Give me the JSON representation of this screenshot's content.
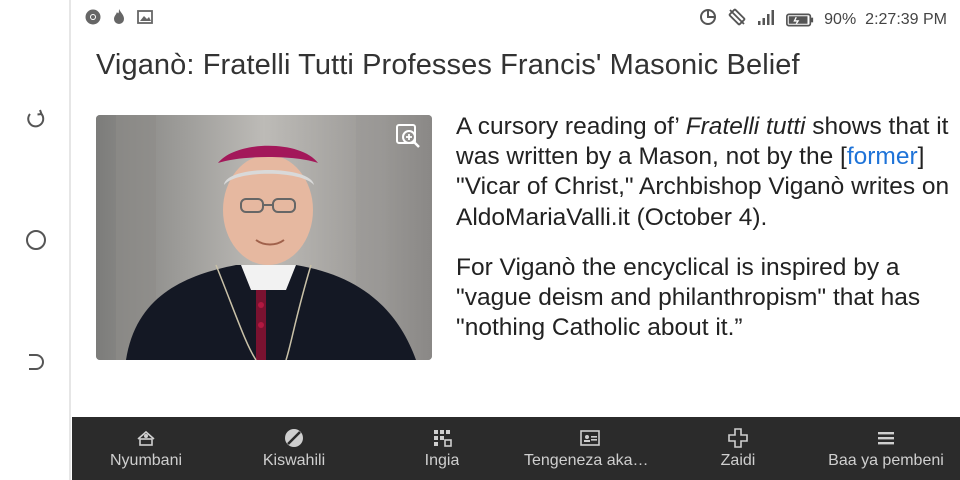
{
  "status_bar": {
    "battery": "90%",
    "time": "2:27:39 PM",
    "left_icons": [
      "chrome-icon",
      "flame-icon",
      "image-icon"
    ],
    "right_icons": [
      "data-saver-icon",
      "rotate-icon",
      "signal-icon",
      "battery-icon"
    ]
  },
  "nav_buttons": [
    "refresh-icon",
    "home-circle-icon",
    "back-icon"
  ],
  "article": {
    "title": "Viganò: Fratelli Tutti Professes Francis' Masonic Belief",
    "paragraph1": {
      "p1": "A cursory reading of’ ",
      "italic": "Fratelli tutti",
      "p2": " shows that it was written by a Mason, not by the [",
      "link": "former",
      "p3": "] \"Vicar of Christ,\" Archbishop Viganò writes on AldoMariaValli.it (October 4)."
    },
    "paragraph2": "For Viganò the encyclical is inspired by a \"vague deism and philanthropism\" that has \"nothing Catholic about it.”"
  },
  "bottom_nav": {
    "tabs": [
      {
        "label": "Nyumbani",
        "icon": "home-icon"
      },
      {
        "label": "Kiswahili",
        "icon": "language-icon"
      },
      {
        "label": "Ingia",
        "icon": "login-icon"
      },
      {
        "label": "Tengeneza akaunti",
        "icon": "account-card-icon"
      },
      {
        "label": "Zaidi",
        "icon": "plus-icon"
      },
      {
        "label": "Baa ya pembeni",
        "icon": "menu-icon"
      }
    ]
  },
  "colors": {
    "link": "#1e73d8",
    "bottom_bar": "#2b2b2b",
    "bottom_text": "#cfcfcf"
  }
}
